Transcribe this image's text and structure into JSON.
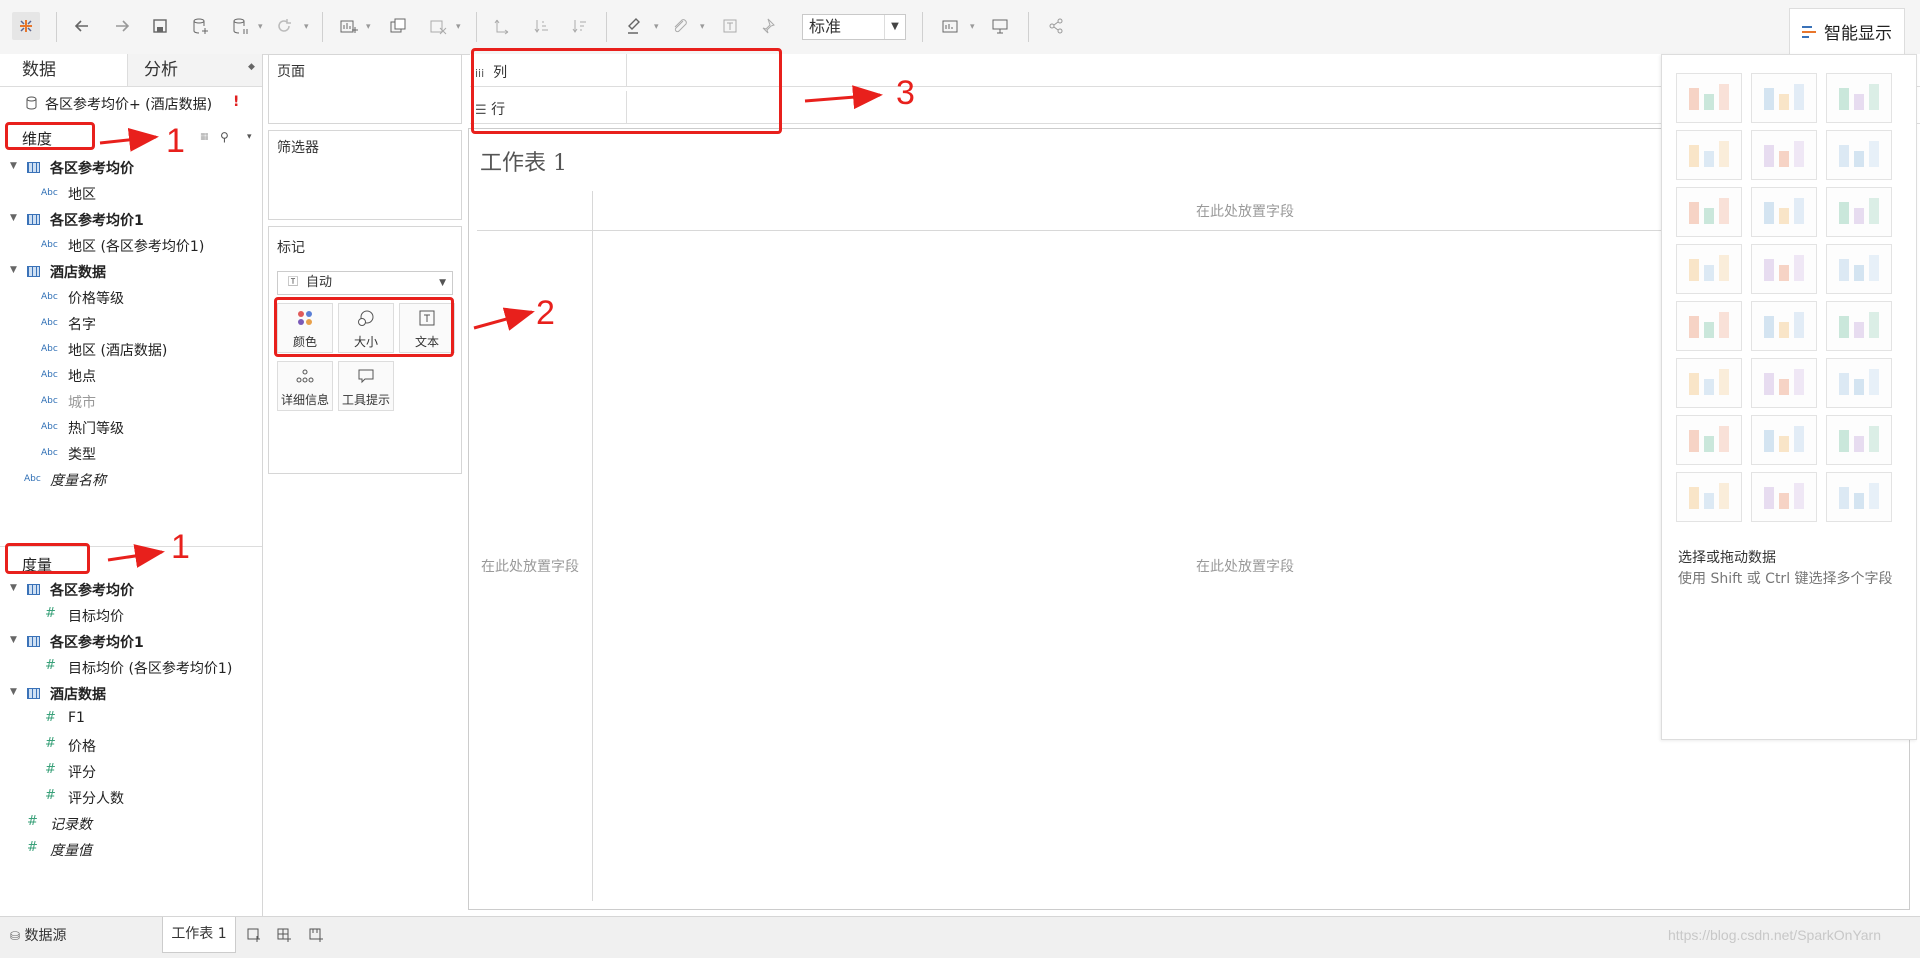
{
  "toolbar": {
    "zoom_value": "标准",
    "show_me_label": "智能显示"
  },
  "data_pane": {
    "tabs": [
      "数据",
      "分析"
    ],
    "datasource": "各区参考均价+ (酒店数据)",
    "datasource_warning": "!",
    "dimensions_header": "维度",
    "dimensions": [
      {
        "type": "group",
        "label": "各区参考均价"
      },
      {
        "type": "abc",
        "label": "地区"
      },
      {
        "type": "group",
        "label": "各区参考均价1"
      },
      {
        "type": "abc",
        "label": "地区 (各区参考均价1)"
      },
      {
        "type": "group",
        "label": "酒店数据"
      },
      {
        "type": "abc",
        "label": "价格等级"
      },
      {
        "type": "abc",
        "label": "名字"
      },
      {
        "type": "abc",
        "label": "地区 (酒店数据)"
      },
      {
        "type": "abc",
        "label": "地点"
      },
      {
        "type": "abc",
        "label": "城市"
      },
      {
        "type": "abc",
        "label": "热门等级"
      },
      {
        "type": "abc",
        "label": "类型"
      },
      {
        "type": "abc-italic",
        "label": "度量名称"
      }
    ],
    "measures_header": "度量",
    "measures": [
      {
        "type": "group",
        "label": "各区参考均价"
      },
      {
        "type": "num",
        "label": "目标均价"
      },
      {
        "type": "group",
        "label": "各区参考均价1"
      },
      {
        "type": "num",
        "label": "目标均价 (各区参考均价1)"
      },
      {
        "type": "group",
        "label": "酒店数据"
      },
      {
        "type": "num",
        "label": "F1"
      },
      {
        "type": "num",
        "label": "价格"
      },
      {
        "type": "num",
        "label": "评分"
      },
      {
        "type": "num",
        "label": "评分人数"
      },
      {
        "type": "num-italic",
        "label": "记录数"
      },
      {
        "type": "num-italic",
        "label": "度量值"
      }
    ]
  },
  "shelves": {
    "pages": "页面",
    "filters": "筛选器",
    "marks": "标记",
    "mark_type": "自动",
    "mark_buttons": [
      "颜色",
      "大小",
      "文本",
      "详细信息",
      "工具提示"
    ],
    "columns": "列",
    "rows": "行"
  },
  "sheet": {
    "title": "工作表 1",
    "drop_top": "在此处放置字段",
    "drop_left": "在此处放置字段",
    "drop_center": "在此处放置字段"
  },
  "show_me": {
    "hint_title": "选择或拖动数据",
    "hint_body": "使用 Shift 或 Ctrl 键选择多个字段"
  },
  "bottom": {
    "datasource_tab": "数据源",
    "sheet_tab": "工作表 1"
  },
  "annotations": [
    "1",
    "1",
    "2",
    "3"
  ],
  "watermark": "https://blog.csdn.net/SparkOnYarn",
  "colors": {
    "annotation": "#e8201c",
    "group_icon": "#3a72b8",
    "measure_icon": "#3aa17a"
  }
}
